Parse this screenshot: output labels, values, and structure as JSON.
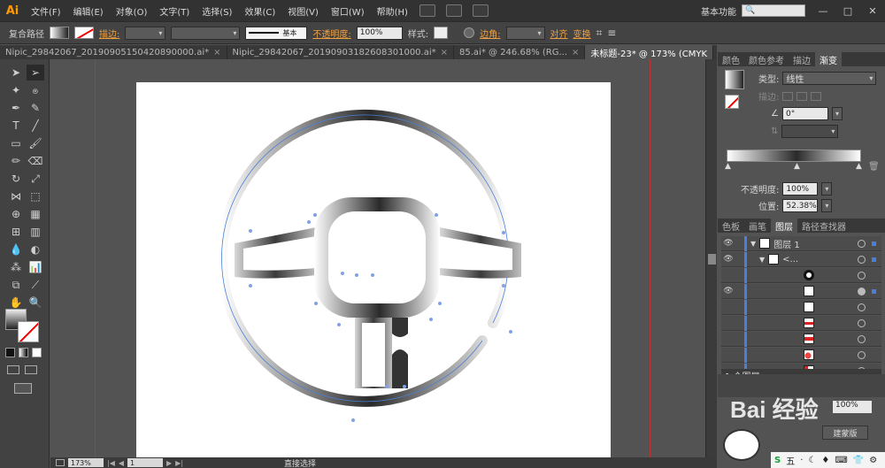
{
  "app": {
    "logo": "Ai"
  },
  "menu": [
    "文件(F)",
    "编辑(E)",
    "对象(O)",
    "文字(T)",
    "选择(S)",
    "效果(C)",
    "视图(V)",
    "窗口(W)",
    "帮助(H)"
  ],
  "workspace": "基本功能",
  "window_buttons": [
    "—",
    "□",
    "✕"
  ],
  "control": {
    "selection": "复合路径",
    "stroke_label": "描边:",
    "stroke_style": "基本",
    "opacity_label": "不透明度:",
    "opacity_value": "100%",
    "style_label": "样式:",
    "corner_label": "边角:",
    "align_label": "对齐",
    "transform_label": "变换"
  },
  "tabs": [
    {
      "label": "Nipic_29842067_20190905150420890000.ai*",
      "close": "×"
    },
    {
      "label": "Nipic_29842067_20190903182608301000.ai*",
      "close": "×"
    },
    {
      "label": "85.ai* @ 246.68% (RG...",
      "close": "×"
    },
    {
      "label": "未标题-23* @ 173% (CMYK",
      "close": ""
    }
  ],
  "gradient_panel": {
    "tabs": [
      "颜色",
      "颜色参考",
      "描边",
      "渐变"
    ],
    "type_label": "类型:",
    "type_value": "线性",
    "stroke_label": "描边:",
    "angle_value": "0°",
    "opacity_label": "不透明度:",
    "opacity_value": "100%",
    "location_label": "位置:",
    "location_value": "52.38%"
  },
  "layers_panel": {
    "tabs": [
      "色板",
      "画笔",
      "图层",
      "路径查找器"
    ],
    "layer_name": "图层 1",
    "group_name": "<...",
    "footer": "1 个图层"
  },
  "status": {
    "zoom": "173%",
    "page": "1",
    "tool": "直接选择"
  },
  "overlay": {
    "watermark": "Bai 经验",
    "field_value": "100%",
    "button": "建蒙版",
    "taskbar": [
      "S",
      "五",
      "·",
      "☾",
      "♦",
      "⌨",
      "👕",
      "⚙"
    ]
  },
  "colors": {
    "accent": "#ff9a00",
    "selection": "#4a7fd8",
    "guide": "#bb3333"
  }
}
